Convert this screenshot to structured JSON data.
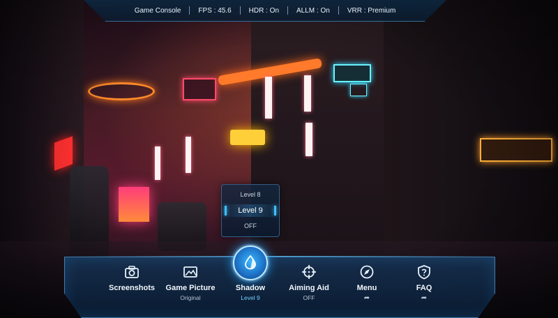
{
  "topbar": {
    "title": "Game Console",
    "fps": "FPS : 45.6",
    "hdr": "HDR : On",
    "allm": "ALLM : On",
    "vrr": "VRR : Premium"
  },
  "shadow_dropdown": {
    "options": [
      "Level 8",
      "Level 9",
      "OFF"
    ],
    "selected": "Level 9"
  },
  "toolbar": {
    "items": [
      {
        "label": "Screenshots",
        "sub": "",
        "icon": "camera-icon"
      },
      {
        "label": "Game Picture",
        "sub": "Original",
        "icon": "picture-icon"
      },
      {
        "label": "Shadow",
        "sub": "Level 9",
        "icon": "shadow-drop-icon",
        "active": true
      },
      {
        "label": "Aiming Aid",
        "sub": "OFF",
        "icon": "crosshair-icon"
      },
      {
        "label": "Menu",
        "sub": "➦",
        "icon": "menu-compass-icon"
      },
      {
        "label": "FAQ",
        "sub": "➦",
        "icon": "faq-shield-icon"
      }
    ]
  },
  "colors": {
    "accent": "#3fc0ff",
    "panel": "#0e2240",
    "text": "#f2f7fc"
  }
}
